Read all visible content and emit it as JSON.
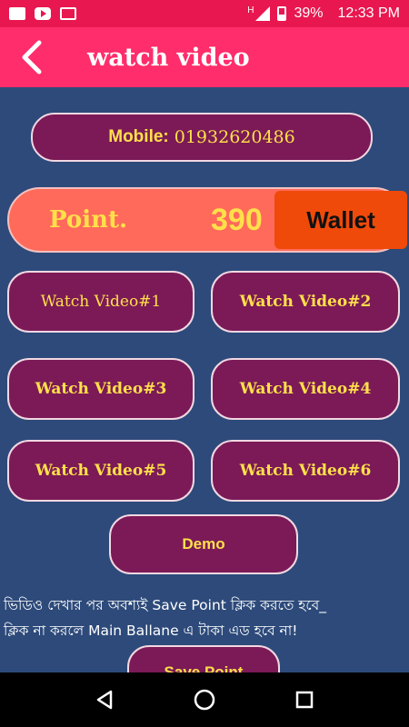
{
  "status_bar": {
    "network_type": "H",
    "battery_percent": "39%",
    "time": "12:33 PM",
    "icons": [
      "message-icon",
      "youtube-icon",
      "gallery-icon",
      "signal-icon",
      "battery-icon"
    ]
  },
  "app_bar": {
    "title": "watch video",
    "back_icon": "back-arrow-icon",
    "color": "#ff2d6b"
  },
  "mobile": {
    "label": "Mobile:",
    "number": "01932620486"
  },
  "points": {
    "label": "Point.",
    "value": "390",
    "wallet_label": "Wallet"
  },
  "video_buttons": [
    {
      "label": "Watch Video#1"
    },
    {
      "label": "Watch Video#2"
    },
    {
      "label": "Watch Video#3"
    },
    {
      "label": "Watch Video#4"
    },
    {
      "label": "Watch Video#5"
    },
    {
      "label": "Watch Video#6"
    }
  ],
  "demo_label": "Demo",
  "note_line1": "ভিডিও দেখার পর অবশ্যই Save Point ক্লিক করতে হবে_",
  "note_line2": "ক্লিক না করলে Main Ballane এ টাকা এড হবে না!",
  "save_label": "Save Point",
  "nav_bar": {
    "icons": [
      "back-triangle-icon",
      "home-circle-icon",
      "recents-square-icon"
    ]
  },
  "colors": {
    "background": "#2d4a7a",
    "button_fill": "#7b1a57",
    "button_text": "#ffe04a",
    "points_bar": "#ff6a5a",
    "wallet": "#f04a0a"
  }
}
